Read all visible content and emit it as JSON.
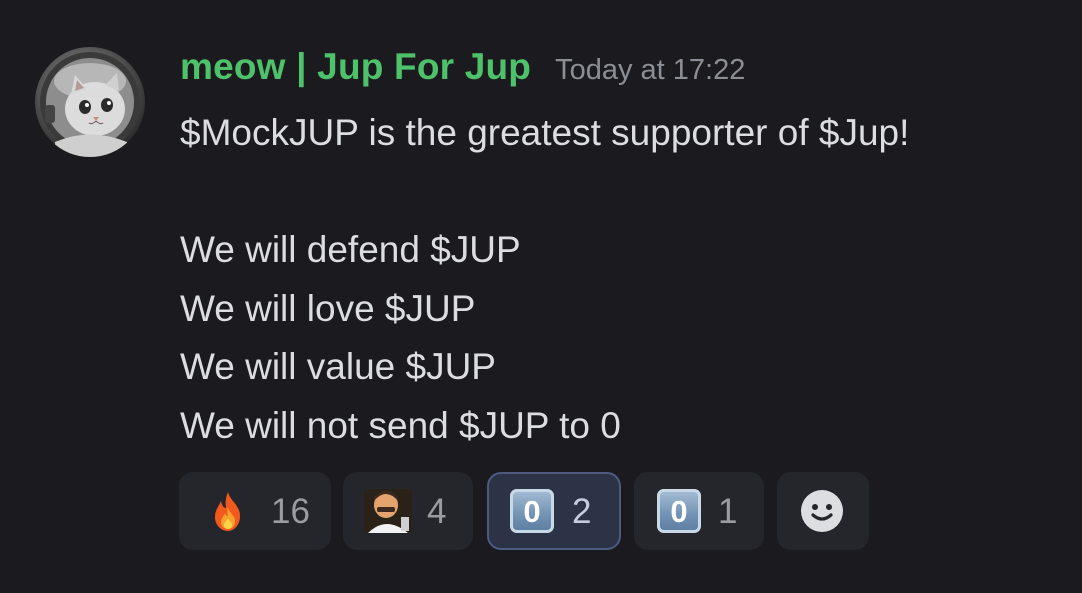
{
  "message": {
    "author": "meow | Jup For Jup",
    "timestamp": "Today at 17:22",
    "lines": [
      "$MockJUP is the greatest supporter of $Jup!",
      "",
      "We will defend $JUP",
      "We will love $JUP",
      "We will value $JUP",
      "We will not send $JUP to 0"
    ],
    "author_color": "#4ec26a"
  },
  "reactions": [
    {
      "emoji": "fire",
      "count": "16",
      "active": false
    },
    {
      "emoji": "custom-man-emoji",
      "count": "4",
      "active": false
    },
    {
      "emoji": "keycap-0",
      "keycap_label": "0",
      "count": "2",
      "active": true
    },
    {
      "emoji": "keycap-0",
      "keycap_label": "0",
      "count": "1",
      "active": false
    }
  ],
  "add_reaction": {
    "icon": "smiley-icon"
  }
}
